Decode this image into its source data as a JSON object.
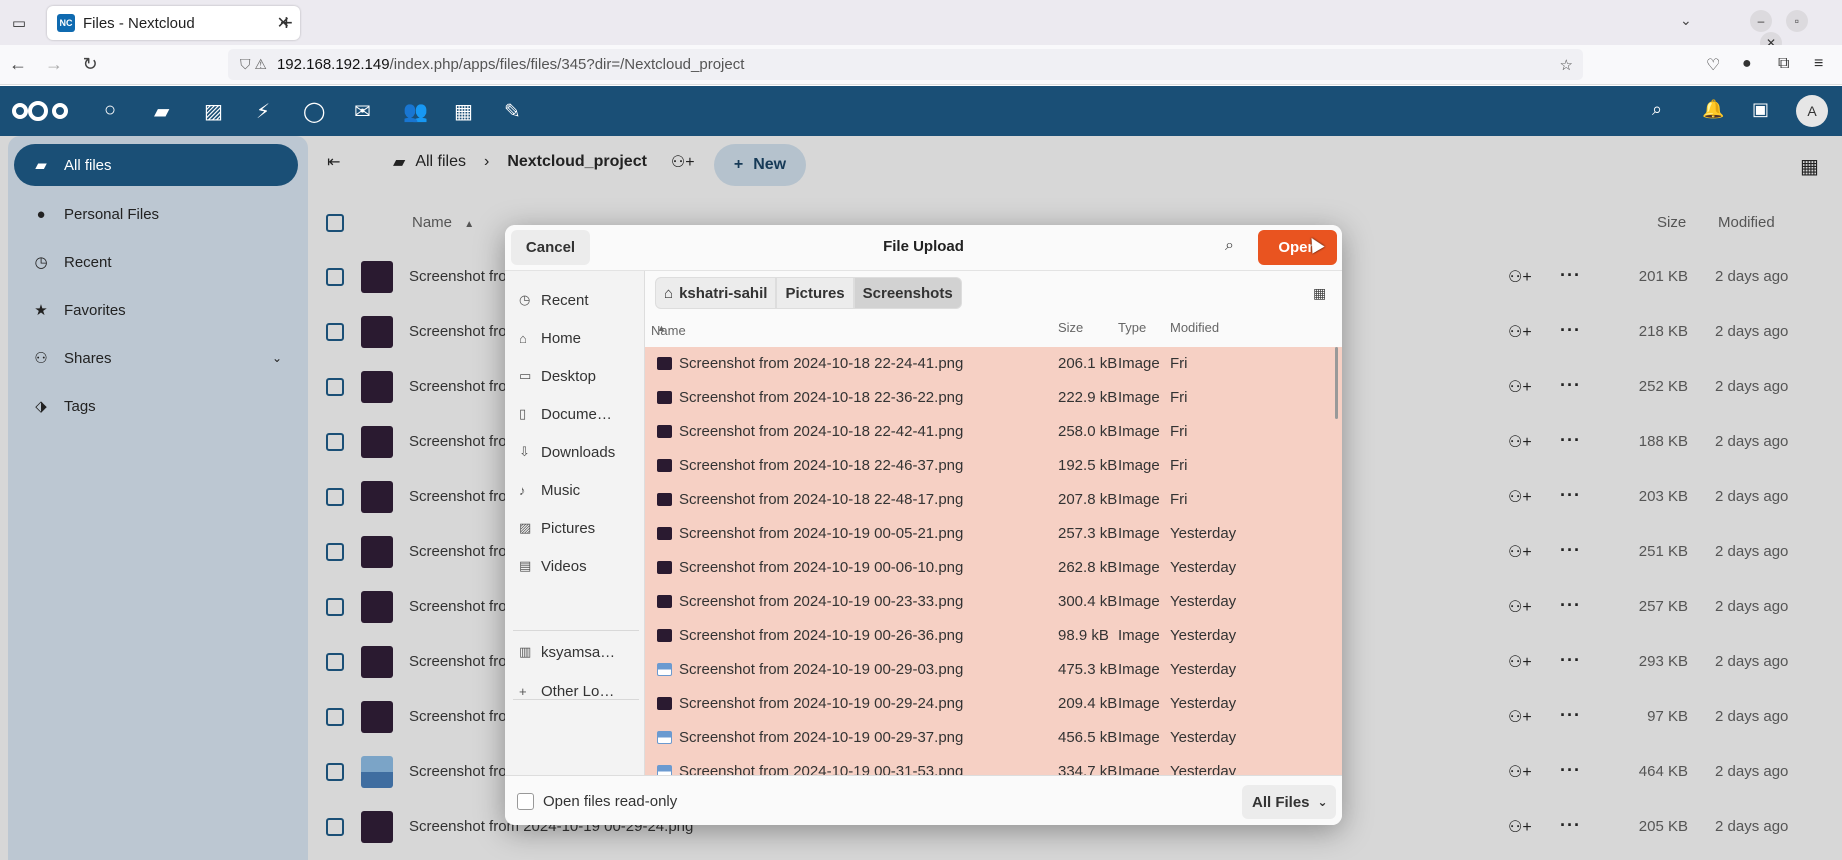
{
  "browser": {
    "tab_title": "Files - Nextcloud",
    "favicon_text": "NC",
    "url_host": "192.168.192.149",
    "url_path": "/index.php/apps/files/files/345?dir=/Nextcloud_project"
  },
  "nextcloud": {
    "avatar_initial": "A",
    "sidebar": [
      {
        "label": "All files",
        "icon": "folder-icon"
      },
      {
        "label": "Personal Files",
        "icon": "person-icon"
      },
      {
        "label": "Recent",
        "icon": "history-icon"
      },
      {
        "label": "Favorites",
        "icon": "star-icon"
      },
      {
        "label": "Shares",
        "icon": "share-icon"
      },
      {
        "label": "Tags",
        "icon": "tag-icon"
      }
    ],
    "breadcrumb": {
      "root": "All files",
      "current": "Nextcloud_project"
    },
    "new_button": "New",
    "columns": {
      "name": "Name",
      "size": "Size",
      "modified": "Modified"
    },
    "files": [
      {
        "name": "Screenshot fro",
        "size": "201 KB",
        "modified": "2 days ago"
      },
      {
        "name": "Screenshot fro",
        "size": "218 KB",
        "modified": "2 days ago"
      },
      {
        "name": "Screenshot fro",
        "size": "252 KB",
        "modified": "2 days ago"
      },
      {
        "name": "Screenshot fro",
        "size": "188 KB",
        "modified": "2 days ago"
      },
      {
        "name": "Screenshot fro",
        "size": "203 KB",
        "modified": "2 days ago"
      },
      {
        "name": "Screenshot fro",
        "size": "251 KB",
        "modified": "2 days ago"
      },
      {
        "name": "Screenshot fro",
        "size": "257 KB",
        "modified": "2 days ago"
      },
      {
        "name": "Screenshot fro",
        "size": "293 KB",
        "modified": "2 days ago"
      },
      {
        "name": "Screenshot fro",
        "size": "97 KB",
        "modified": "2 days ago"
      },
      {
        "name": "Screenshot fro",
        "size": "464 KB",
        "modified": "2 days ago"
      },
      {
        "name": "Screenshot from 2024-10-19 00-29-24.png",
        "size": "205 KB",
        "modified": "2 days ago"
      }
    ]
  },
  "dialog": {
    "title": "File Upload",
    "cancel": "Cancel",
    "open": "Open",
    "places": [
      "Recent",
      "Home",
      "Desktop",
      "Docume…",
      "Downloads",
      "Music",
      "Pictures",
      "Videos",
      "ksyamsa…",
      "Other Lo…"
    ],
    "path": [
      "kshatri-sahil",
      "Pictures",
      "Screenshots"
    ],
    "columns": {
      "name": "Name",
      "size": "Size",
      "type": "Type",
      "modified": "Modified"
    },
    "files": [
      {
        "name": "Screenshot from 2024-10-18 22-24-41.png",
        "size": "206.1 kB",
        "type": "Image",
        "modified": "Fri"
      },
      {
        "name": "Screenshot from 2024-10-18 22-36-22.png",
        "size": "222.9 kB",
        "type": "Image",
        "modified": "Fri"
      },
      {
        "name": "Screenshot from 2024-10-18 22-42-41.png",
        "size": "258.0 kB",
        "type": "Image",
        "modified": "Fri"
      },
      {
        "name": "Screenshot from 2024-10-18 22-46-37.png",
        "size": "192.5 kB",
        "type": "Image",
        "modified": "Fri"
      },
      {
        "name": "Screenshot from 2024-10-18 22-48-17.png",
        "size": "207.8 kB",
        "type": "Image",
        "modified": "Fri"
      },
      {
        "name": "Screenshot from 2024-10-19 00-05-21.png",
        "size": "257.3 kB",
        "type": "Image",
        "modified": "Yesterday"
      },
      {
        "name": "Screenshot from 2024-10-19 00-06-10.png",
        "size": "262.8 kB",
        "type": "Image",
        "modified": "Yesterday"
      },
      {
        "name": "Screenshot from 2024-10-19 00-23-33.png",
        "size": "300.4 kB",
        "type": "Image",
        "modified": "Yesterday"
      },
      {
        "name": "Screenshot from 2024-10-19 00-26-36.png",
        "size": "98.9 kB",
        "type": "Image",
        "modified": "Yesterday"
      },
      {
        "name": "Screenshot from 2024-10-19 00-29-03.png",
        "size": "475.3 kB",
        "type": "Image",
        "modified": "Yesterday"
      },
      {
        "name": "Screenshot from 2024-10-19 00-29-24.png",
        "size": "209.4 kB",
        "type": "Image",
        "modified": "Yesterday"
      },
      {
        "name": "Screenshot from 2024-10-19 00-29-37.png",
        "size": "456.5 kB",
        "type": "Image",
        "modified": "Yesterday"
      },
      {
        "name": "Screenshot from 2024-10-19 00-31-53.png",
        "size": "334.7 kB",
        "type": "Image",
        "modified": "Yesterday"
      }
    ],
    "readonly_label": "Open files read-only",
    "filter": "All Files"
  }
}
